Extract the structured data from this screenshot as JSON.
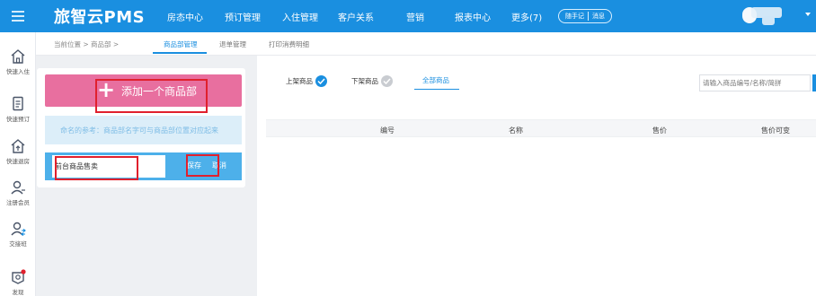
{
  "topbar": {
    "brand": "旅智云PMS",
    "nav": [
      "房态中心",
      "预订管理",
      "入住管理",
      "客户关系",
      "营销",
      "报表中心",
      "更多(7)"
    ],
    "pills": [
      "随手记",
      "消息"
    ],
    "menu_icon": "menu-toggle-icon",
    "dropdown_icon": "caret-down-icon"
  },
  "sidebar": {
    "items": [
      {
        "label": "快速入住",
        "icon": "home-icon"
      },
      {
        "label": "快速预订",
        "icon": "document-icon"
      },
      {
        "label": "快速退房",
        "icon": "checkout-house-icon"
      },
      {
        "label": "注册会员",
        "icon": "user-add-icon"
      },
      {
        "label": "交接班",
        "icon": "user-switch-icon"
      },
      {
        "label": "发现",
        "icon": "discover-icon"
      }
    ]
  },
  "breadcrumb": {
    "text": "当前位置 > 商品部 >",
    "tabs": [
      "商品部管理",
      "退单管理",
      "打印消费明细"
    ],
    "active_tab": "商品部管理"
  },
  "department": {
    "add_label": "添加一个商品部",
    "add_icon": "plus-icon",
    "hint": "命名的参考：商品部名字可与商品部位置对应起来",
    "input_value": "前台商品售卖",
    "save_label": "保存",
    "cancel_label": "取消"
  },
  "goods": {
    "filters": [
      "上架商品",
      "下架商品",
      "全部商品"
    ],
    "active_filter": "全部商品",
    "search_placeholder": "请输入商品编号/名称/简拼",
    "columns": [
      "编号",
      "名称",
      "售价",
      "售价可变"
    ]
  },
  "colors": {
    "primary": "#1a8fe0",
    "add_button": "#e86f9f",
    "hint_bg": "#dceef9",
    "edit_row": "#4db0ea",
    "highlight": "#e0202d"
  }
}
